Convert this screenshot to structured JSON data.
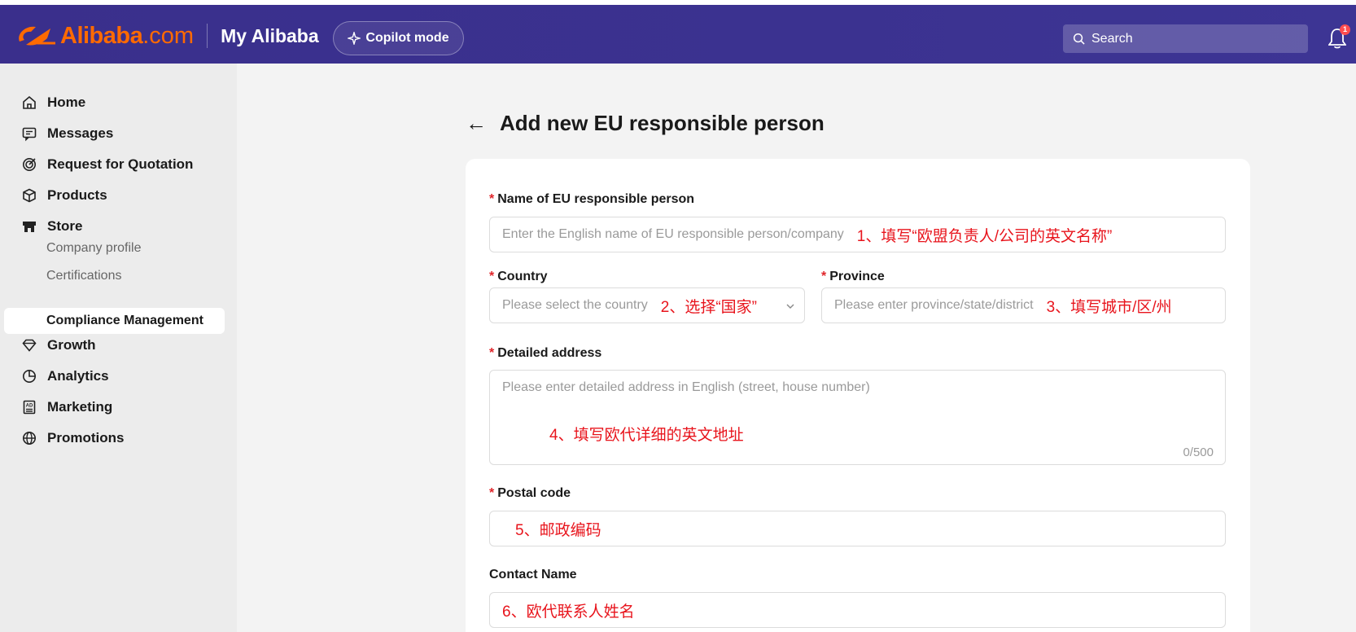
{
  "header": {
    "logo_text": "Alibaba",
    "logo_suffix": ".com",
    "section": "My Alibaba",
    "copilot_label": "Copilot mode",
    "search_placeholder": "Search",
    "notification_count": "1"
  },
  "sidebar": {
    "items": [
      {
        "label": "Home",
        "icon": "home-icon"
      },
      {
        "label": "Messages",
        "icon": "message-icon"
      },
      {
        "label": "Request for Quotation",
        "icon": "target-icon"
      },
      {
        "label": "Products",
        "icon": "box-icon"
      },
      {
        "label": "Store",
        "icon": "store-icon"
      },
      {
        "label": "Growth",
        "icon": "diamond-icon"
      },
      {
        "label": "Analytics",
        "icon": "pie-chart-icon"
      },
      {
        "label": "Marketing",
        "icon": "ad-icon"
      },
      {
        "label": "Promotions",
        "icon": "globe-icon"
      }
    ],
    "store_sub": [
      "Company profile",
      "Certifications",
      "Compliance Management"
    ],
    "active": "Compliance Management"
  },
  "form": {
    "title": "Add new EU responsible person",
    "name": {
      "label": "Name of EU responsible person",
      "placeholder": "Enter the English name of EU responsible person/company",
      "note": "1、填写“欧盟负责人/公司的英文名称”"
    },
    "country": {
      "label": "Country",
      "placeholder": "Please select the country",
      "note": "2、选择“国家”"
    },
    "province": {
      "label": "Province",
      "placeholder": "Please enter province/state/district",
      "note": "3、填写城市/区/州"
    },
    "address": {
      "label": "Detailed address",
      "placeholder": "Please enter detailed address in English (street, house number)",
      "note": "4、填写欧代详细的英文地址",
      "counter": "0/500"
    },
    "postal": {
      "label": "Postal code",
      "note": "5、邮政编码"
    },
    "contact": {
      "label": "Contact Name",
      "note": "6、欧代联系人姓名"
    },
    "required_mark": "*"
  }
}
